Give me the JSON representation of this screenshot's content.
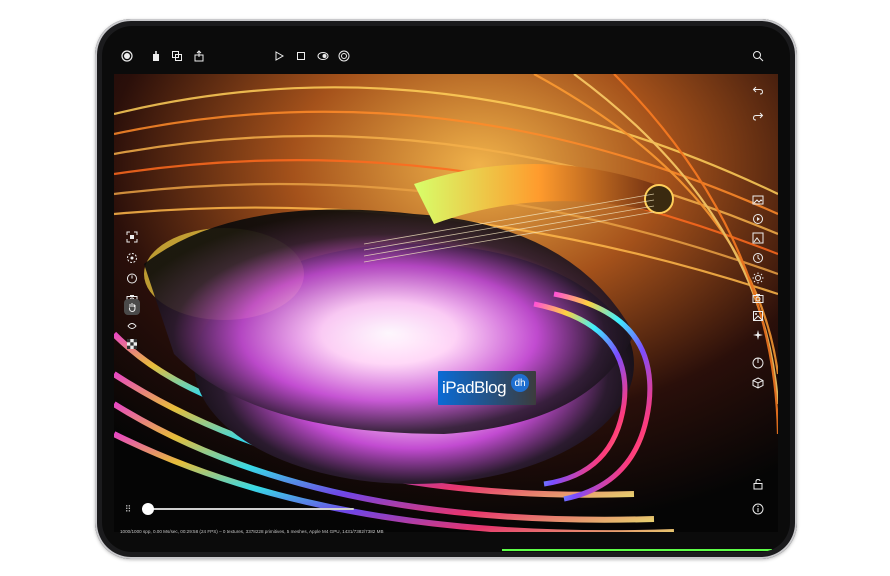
{
  "app": {
    "status_line": "1000/1000 spp, 0.00 Ms/sec, 00:29:58 (24 FPS) – 0 textures, 3378228 primitives, 5 meshes, Apple M4 GPU, 1431/7382/7382 MB"
  },
  "top_toolbar": {
    "left_icons": [
      "record-icon",
      "share-icon",
      "duplicate-icon",
      "export-icon"
    ],
    "center_icons": [
      "play-icon",
      "stop-icon",
      "mask-icon",
      "target-icon"
    ],
    "right_icons": [
      "zoom-icon"
    ]
  },
  "left_toolbar": {
    "icons": [
      "frame-icon",
      "focus-icon",
      "timer-icon",
      "camera-icon",
      "hand-icon",
      "pan-icon",
      "checker-icon"
    ],
    "active": "hand-icon"
  },
  "right_toolbar": {
    "icons": [
      "undo-icon",
      "redo-icon",
      "image-icon",
      "video-icon",
      "gallery-icon",
      "clock-icon",
      "sun-icon",
      "camera-icon",
      "photo-icon",
      "sparkle-icon",
      "dial-icon",
      "cube-icon",
      "unlock-icon",
      "info-icon"
    ]
  },
  "timeline": {
    "progress": 0.0
  },
  "watermark": {
    "text": "iPadBlog",
    "badge": "dh"
  },
  "colors": {
    "bezel": "#1b1b1d",
    "screen": "#0b0b0b",
    "accent_green": "#5dff47"
  }
}
